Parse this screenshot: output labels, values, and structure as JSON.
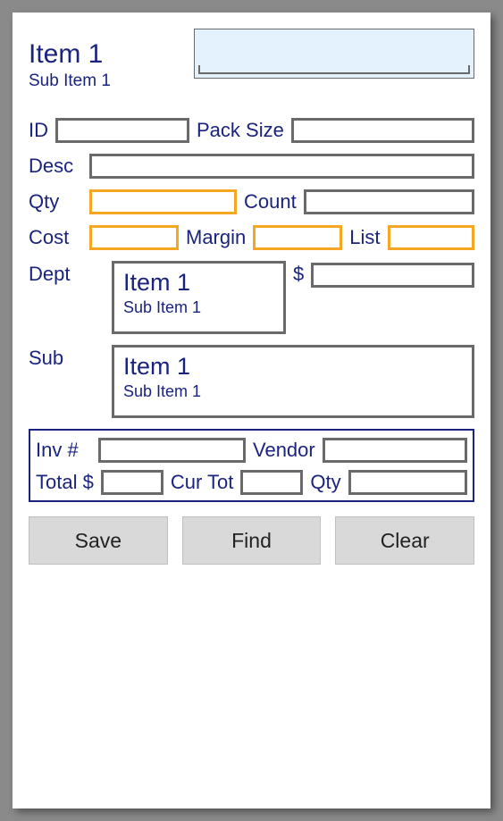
{
  "header": {
    "title": "Item 1",
    "subtitle": "Sub Item 1",
    "search_value": ""
  },
  "labels": {
    "id": "ID",
    "pack_size": "Pack Size",
    "desc": "Desc",
    "qty": "Qty",
    "count": "Count",
    "cost": "Cost",
    "margin": "Margin",
    "list": "List",
    "dept": "Dept",
    "dollar": "$",
    "sub": "Sub",
    "inv_no": "Inv #",
    "vendor": "Vendor",
    "total_dollar": "Total $",
    "cur_tot": "Cur Tot",
    "inv_qty": "Qty"
  },
  "fields": {
    "id": "",
    "pack_size": "",
    "desc": "",
    "qty": "",
    "count": "",
    "cost": "",
    "margin": "",
    "list": "",
    "dollar": "",
    "inv_no": "",
    "vendor": "",
    "total_dollar": "",
    "cur_tot": "",
    "inv_qty": ""
  },
  "dept_box": {
    "title": "Item 1",
    "subtitle": "Sub Item 1"
  },
  "sub_box": {
    "title": "Item 1",
    "subtitle": "Sub Item 1"
  },
  "buttons": {
    "save": "Save",
    "find": "Find",
    "clear": "Clear"
  }
}
